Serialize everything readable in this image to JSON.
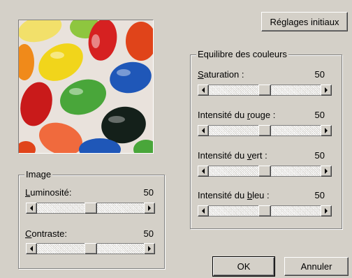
{
  "buttons": {
    "reset_label": "Réglages initiaux",
    "ok_label": "OK",
    "cancel_label": "Annuler"
  },
  "preview": {
    "image_name": "jelly-beans-preview"
  },
  "image_group": {
    "title": "Image",
    "brightness": {
      "label_pre": "",
      "label_u": "L",
      "label_post": "uminosité:",
      "value": "50",
      "fraction": 0.5
    },
    "contrast": {
      "label_pre": "",
      "label_u": "C",
      "label_post": "ontraste:",
      "value": "50",
      "fraction": 0.5
    }
  },
  "balance_group": {
    "title": "Equilibre des couleurs",
    "saturation": {
      "label_pre": "",
      "label_u": "S",
      "label_post": "aturation :",
      "value": "50",
      "fraction": 0.5
    },
    "red": {
      "label_pre": "Intensité du ",
      "label_u": "r",
      "label_post": "ouge :",
      "value": "50",
      "fraction": 0.5
    },
    "green": {
      "label_pre": "Intensité du ",
      "label_u": "v",
      "label_post": "ert :",
      "value": "50",
      "fraction": 0.5
    },
    "blue": {
      "label_pre": "Intensité du ",
      "label_u": "b",
      "label_post": "leu :",
      "value": "50",
      "fraction": 0.5
    }
  },
  "colors": {
    "dialog_bg": "#d4d0c8"
  }
}
